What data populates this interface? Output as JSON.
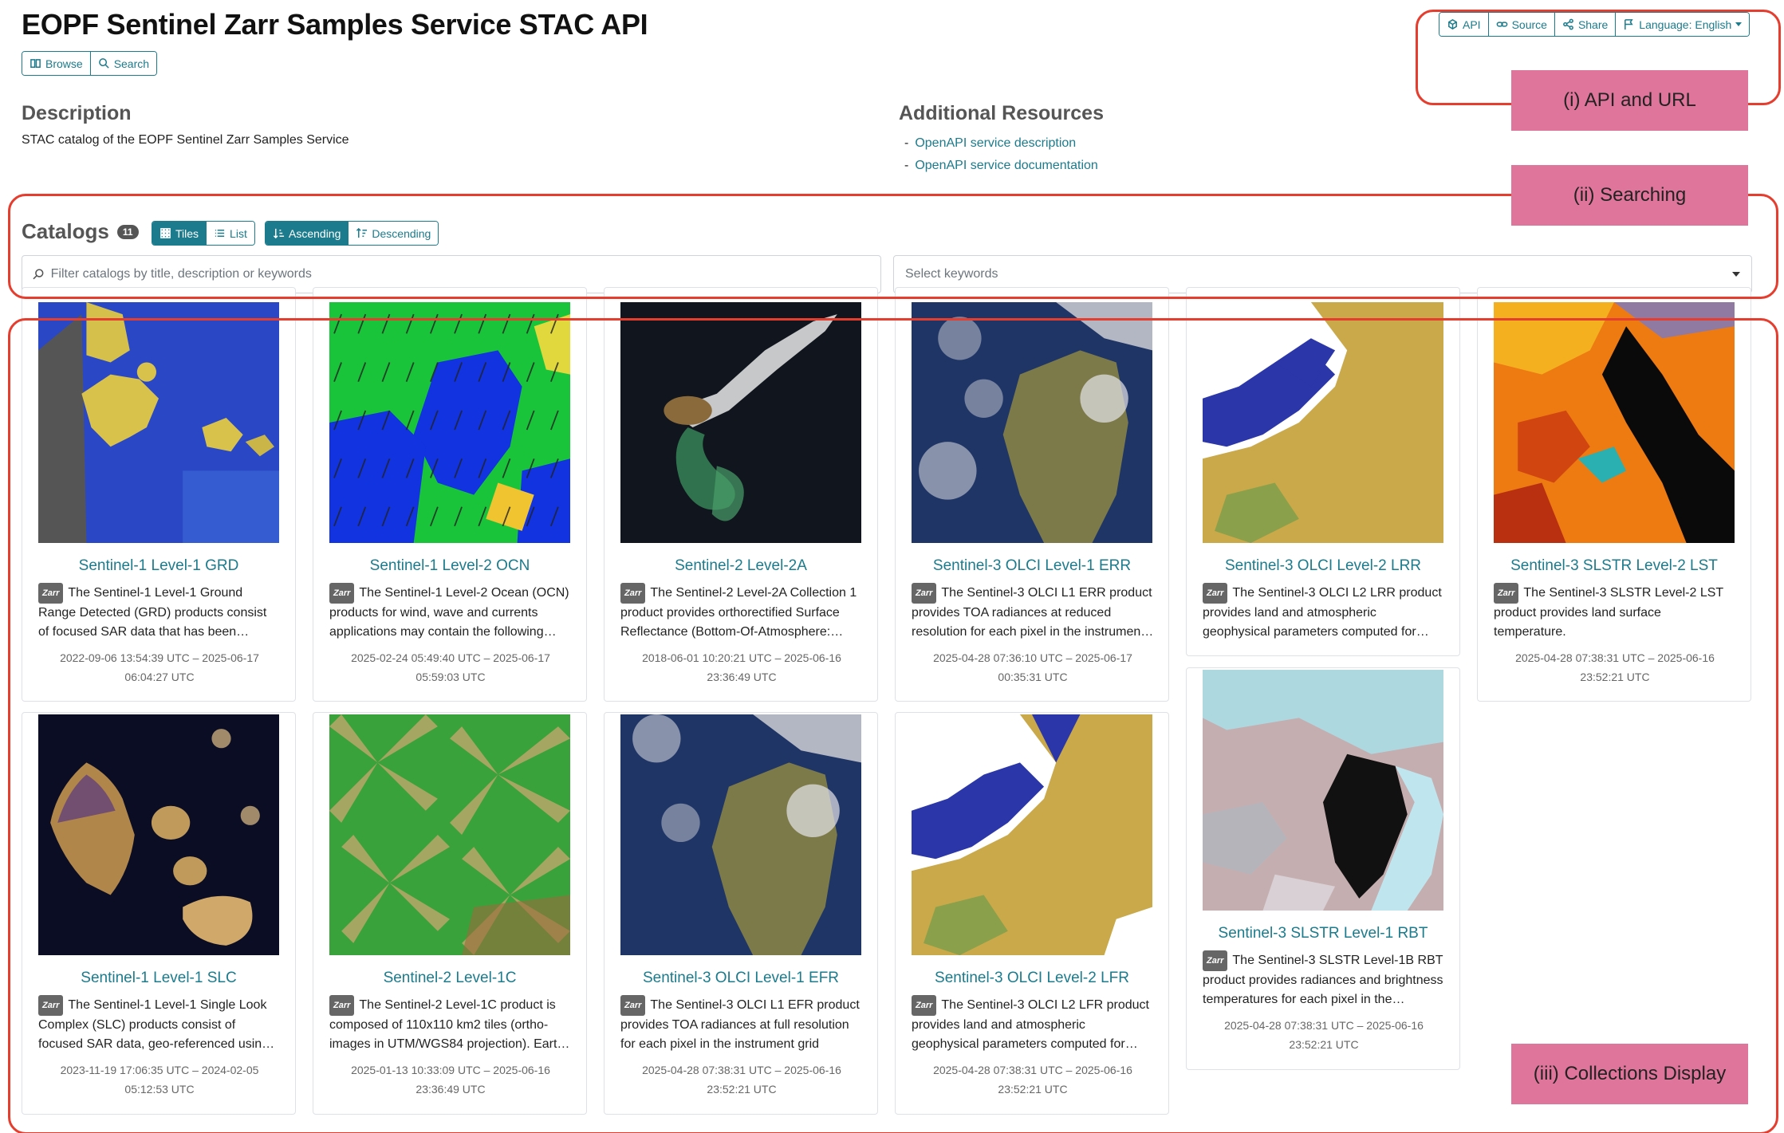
{
  "header": {
    "title": "EOPF Sentinel Zarr Samples Service STAC API",
    "nav": {
      "browse": "Browse",
      "search": "Search"
    },
    "toolbar": {
      "api": "API",
      "source": "Source",
      "share": "Share",
      "language": "Language: English"
    }
  },
  "description": {
    "heading": "Description",
    "text": "STAC catalog of the EOPF Sentinel Zarr Samples Service"
  },
  "resources": {
    "heading": "Additional Resources",
    "links": [
      "OpenAPI service description",
      "OpenAPI service documentation"
    ]
  },
  "catalogs": {
    "heading": "Catalogs",
    "count": "11",
    "view": {
      "tiles": "Tiles",
      "list": "List"
    },
    "sort": {
      "asc": "Ascending",
      "desc": "Descending"
    },
    "filter_placeholder": "Filter catalogs by title, description or keywords",
    "keywords_placeholder": "Select keywords"
  },
  "badge": "Zarr",
  "cards": [
    {
      "title": "Sentinel-1 Level-1 GRD",
      "desc": "The Sentinel-1 Level-1 Ground Range Detected (GRD) products consist of focused SAR data that has been detected, multi-looked and projected",
      "dates_1": "2022-09-06 13:54:39 UTC – 2025-06-17",
      "dates_2": "06:04:27 UTC"
    },
    {
      "title": "Sentinel-1 Level-2 OCN",
      "desc": "The Sentinel-1 Level-2 Ocean (OCN) products for wind, wave and currents applications may contain the following geophysical components",
      "dates_1": "2025-02-24 05:49:40 UTC – 2025-06-17",
      "dates_2": "05:59:03 UTC"
    },
    {
      "title": "Sentinel-2 Level-2A",
      "desc": "The Sentinel-2 Level-2A Collection 1 product provides orthorectified Surface Reflectance (Bottom-Of-Atmosphere: BOA)",
      "dates_1": "2018-06-01 10:20:21 UTC – 2025-06-16",
      "dates_2": "23:36:49 UTC"
    },
    {
      "title": "Sentinel-3 OLCI Level-1 ERR",
      "desc": "The Sentinel-3 OLCI L1 ERR product provides TOA radiances at reduced resolution for each pixel in the instrument grid",
      "dates_1": "2025-04-28 07:36:10 UTC – 2025-06-17",
      "dates_2": "00:35:31 UTC"
    },
    {
      "title": "Sentinel-3 OLCI Level-2 LRR",
      "desc": "The Sentinel-3 OLCI L2 LRR product provides land and atmospheric geophysical parameters computed for each pixel",
      "dates_1": "",
      "dates_2": ""
    },
    {
      "title": "Sentinel-3 SLSTR Level-2 LST",
      "desc": "The Sentinel-3 SLSTR Level-2 LST product provides land surface temperature.",
      "dates_1": "2025-04-28 07:38:31 UTC – 2025-06-16",
      "dates_2": "23:52:21 UTC"
    },
    {
      "title": "Sentinel-1 Level-1 SLC",
      "desc": "The Sentinel-1 Level-1 Single Look Complex (SLC) products consist of focused SAR data, geo-referenced using orbit and attitude data",
      "dates_1": "2023-11-19 17:06:35 UTC – 2024-02-05",
      "dates_2": "05:12:53 UTC"
    },
    {
      "title": "Sentinel-2 Level-1C",
      "desc": "The Sentinel-2 Level-1C product is composed of 110x110 km2 tiles (ortho-images in UTM/WGS84 projection). Earth is subdivided",
      "dates_1": "2025-01-13 10:33:09 UTC – 2025-06-16",
      "dates_2": "23:36:49 UTC"
    },
    {
      "title": "Sentinel-3 OLCI Level-1 EFR",
      "desc": "The Sentinel-3 OLCI L1 EFR product provides TOA radiances at full resolution for each pixel in the instrument grid",
      "dates_1": "2025-04-28 07:38:31 UTC – 2025-06-16",
      "dates_2": "23:52:21 UTC"
    },
    {
      "title": "Sentinel-3 OLCI Level-2 LFR",
      "desc": "The Sentinel-3 OLCI L2 LFR product provides land and atmospheric geophysical parameters computed for each pixel",
      "dates_1": "2025-04-28 07:38:31 UTC – 2025-06-16",
      "dates_2": "23:52:21 UTC"
    },
    {
      "title": "Sentinel-3 SLSTR Level-1 RBT",
      "desc": "The Sentinel-3 SLSTR Level-1B RBT product provides radiances and brightness temperatures for each pixel in the instrument grid",
      "dates_1": "2025-04-28 07:38:31 UTC – 2025-06-16",
      "dates_2": "23:52:21 UTC"
    }
  ],
  "annotations": {
    "api": "(i) API and URL",
    "search": "(ii) Searching",
    "display": "(iii) Collections Display"
  },
  "colors": {
    "accent": "#1c7b8c",
    "annotation_border": "#e53d2e",
    "annotation_fill": "#e0759b"
  }
}
